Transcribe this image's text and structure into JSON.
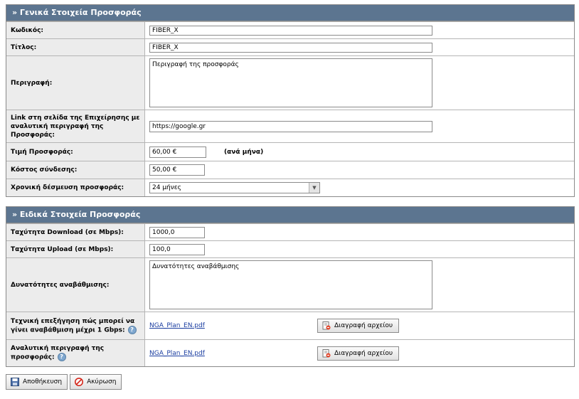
{
  "general": {
    "header": "» Γενικά Στοιχεία Προσφοράς",
    "code_label": "Κωδικός:",
    "code_value": "FIBER_X",
    "title_label": "Τίτλος:",
    "title_value": "FIBER_X",
    "description_label": "Περιγραφή:",
    "description_value": "Περιγραφή της προσφοράς",
    "link_label": "Link στη σελίδα της Επιχείρησης με αναλυτική περιγραφή της Προσφοράς:",
    "link_value": "https://google.gr",
    "price_label": "Τιμή Προσφοράς:",
    "price_value": "60,00 €",
    "price_note": "(ανά μήνα)",
    "connection_cost_label": "Κόστος σύνδεσης:",
    "connection_cost_value": "50,00 €",
    "commitment_label": "Χρονική δέσμευση προσφοράς:",
    "commitment_value": "24 μήνες"
  },
  "specific": {
    "header": "» Ειδικά Στοιχεία Προσφοράς",
    "download_label": "Ταχύτητα Download (σε Mbps):",
    "download_value": "1000,0",
    "upload_label": "Ταχύτητα Upload (σε Mbps):",
    "upload_value": "100,0",
    "upgrade_label": "Δυνατότητες αναβάθμισης:",
    "upgrade_value": "Δυνατότητες αναβάθμισης",
    "tech_label": "Τεχνική επεξήγηση πώς μπορεί να γίνει αναβάθμιση μέχρι 1 Gbps:",
    "tech_file": "NGA_Plan_EN.pdf",
    "detail_label": "Αναλυτική περιγραφή της προσφοράς:",
    "detail_file": "NGA_Plan_EN.pdf",
    "delete_file_label": "Διαγραφή αρχείου"
  },
  "actions": {
    "save_label": "Αποθήκευση",
    "cancel_label": "Ακύρωση"
  },
  "icons": {
    "help": "help-icon",
    "delete": "delete-file-icon",
    "save": "save-icon",
    "cancel": "cancel-icon"
  }
}
